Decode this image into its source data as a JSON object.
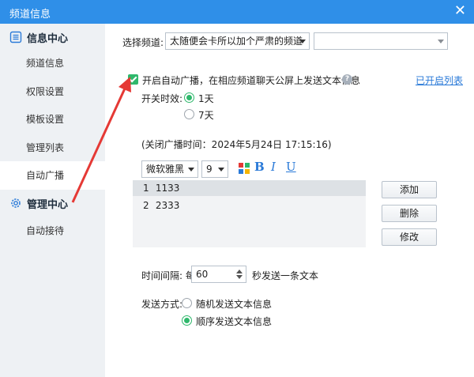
{
  "window": {
    "title": "频道信息",
    "close": "✕"
  },
  "sidebar": {
    "section1": "信息中心",
    "section2": "管理中心",
    "items": [
      {
        "label": "频道信息"
      },
      {
        "label": "权限设置"
      },
      {
        "label": "模板设置"
      },
      {
        "label": "管理列表"
      },
      {
        "label": "自动广播"
      },
      {
        "label": "自动接待"
      }
    ]
  },
  "main": {
    "select_channel_label": "选择频道:",
    "channel_value": "太随便会卡所以加个严肃的频道",
    "sub_channel_value": "",
    "auto_broadcast_checkbox": "开启自动广播，在相应频道聊天公屏上发送文本信息",
    "opened_list_link": "已开启列表",
    "effect_label": "开关时效:",
    "effect_options": [
      "1天",
      "7天"
    ],
    "close_time": "(关闭广播时间：2024年5月24日 17:15:16)",
    "font_name": "微软雅黑",
    "font_size": "9",
    "messages": [
      {
        "num": "1",
        "text": "1133"
      },
      {
        "num": "2",
        "text": "2333"
      }
    ],
    "buttons": {
      "add": "添加",
      "delete": "删除",
      "edit": "修改"
    },
    "interval_label": "时间间隔: 每",
    "interval_value": "60",
    "interval_suffix": "秒发送一条文本",
    "send_mode_label": "发送方式:",
    "send_modes": [
      "随机发送文本信息",
      "顺序发送文本信息"
    ]
  },
  "colors": {
    "titlebar": "#2f8fe8",
    "accent_green": "#2fb86c",
    "link_blue": "#2a7ad8",
    "annotation_red": "#e53935"
  }
}
